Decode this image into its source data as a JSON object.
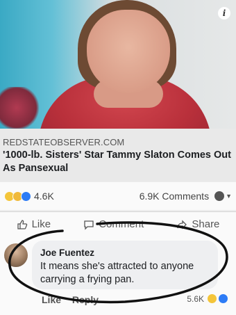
{
  "post": {
    "info_icon_glyph": "i",
    "link": {
      "domain": "REDSTATEOBSERVER.COM",
      "title": "'1000-lb. Sisters' Star Tammy Slaton Comes Out As Pansexual"
    },
    "stats": {
      "reactions_count": "4.6K",
      "comments_count": "6.9K Comments"
    },
    "actions": {
      "like": "Like",
      "comment": "Comment",
      "share": "Share"
    }
  },
  "comment": {
    "author": "Joe Fuentez",
    "text": "It means she's attracted to anyone carrying a frying pan.",
    "actions": {
      "like": "Like",
      "reply": "Reply"
    },
    "reactions_count": "5.6K"
  },
  "colors": {
    "annotation": "#111111",
    "link_blue": "#2d7cf6"
  }
}
